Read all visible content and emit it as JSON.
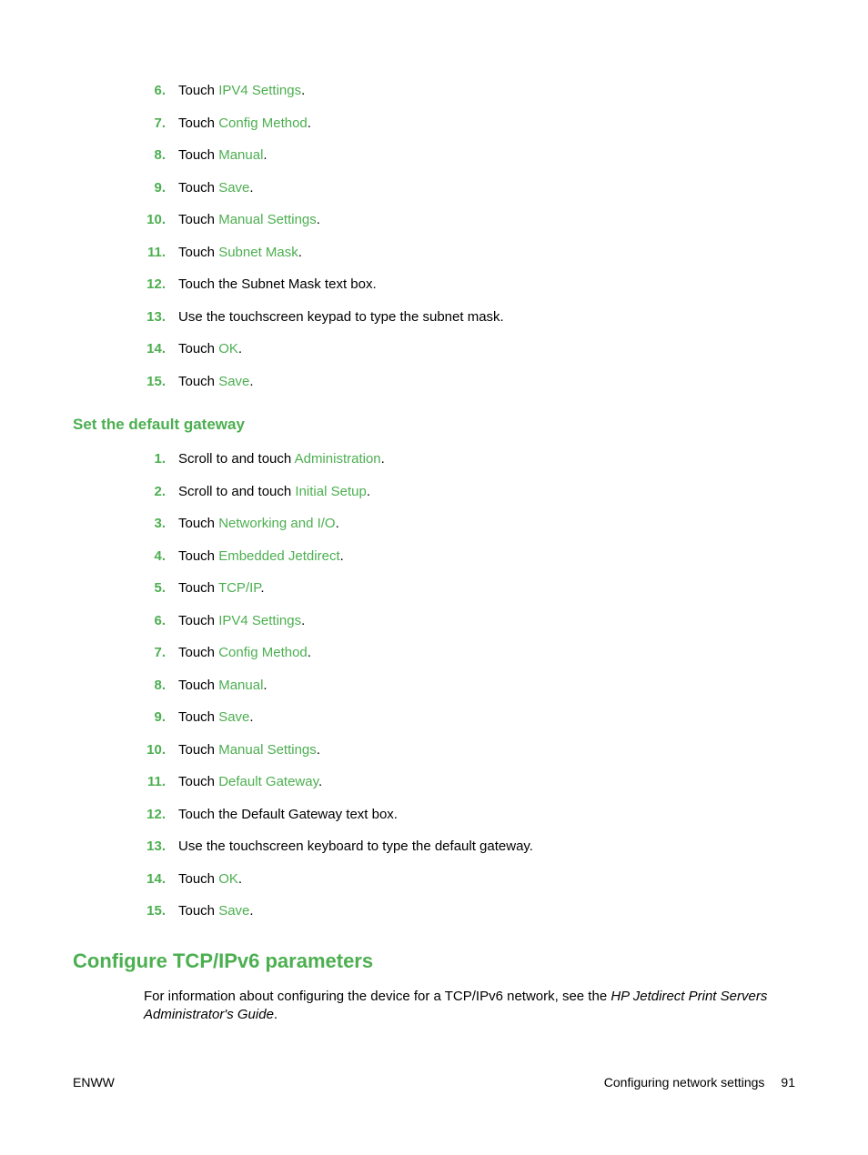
{
  "list1": [
    {
      "n": "6.",
      "pre": "Touch ",
      "link": "IPV4 Settings",
      "post": "."
    },
    {
      "n": "7.",
      "pre": "Touch ",
      "link": "Config Method",
      "post": "."
    },
    {
      "n": "8.",
      "pre": "Touch ",
      "link": "Manual",
      "post": "."
    },
    {
      "n": "9.",
      "pre": "Touch ",
      "link": "Save",
      "post": "."
    },
    {
      "n": "10.",
      "pre": "Touch ",
      "link": "Manual Settings",
      "post": "."
    },
    {
      "n": "11.",
      "pre": "Touch ",
      "link": "Subnet Mask",
      "post": "."
    },
    {
      "n": "12.",
      "pre": "Touch the Subnet Mask text box.",
      "link": "",
      "post": ""
    },
    {
      "n": "13.",
      "pre": "Use the touchscreen keypad to type the subnet mask.",
      "link": "",
      "post": ""
    },
    {
      "n": "14.",
      "pre": "Touch ",
      "link": "OK",
      "post": "."
    },
    {
      "n": "15.",
      "pre": "Touch ",
      "link": "Save",
      "post": "."
    }
  ],
  "subheading1": "Set the default gateway",
  "list2": [
    {
      "n": "1.",
      "pre": "Scroll to and touch ",
      "link": "Administration",
      "post": "."
    },
    {
      "n": "2.",
      "pre": "Scroll to and touch ",
      "link": "Initial Setup",
      "post": "."
    },
    {
      "n": "3.",
      "pre": "Touch ",
      "link": "Networking and I/O",
      "post": "."
    },
    {
      "n": "4.",
      "pre": "Touch ",
      "link": "Embedded Jetdirect",
      "post": "."
    },
    {
      "n": "5.",
      "pre": "Touch ",
      "link": "TCP/IP",
      "post": "."
    },
    {
      "n": "6.",
      "pre": "Touch ",
      "link": "IPV4 Settings",
      "post": "."
    },
    {
      "n": "7.",
      "pre": "Touch ",
      "link": "Config Method",
      "post": "."
    },
    {
      "n": "8.",
      "pre": "Touch ",
      "link": "Manual",
      "post": "."
    },
    {
      "n": "9.",
      "pre": "Touch ",
      "link": "Save",
      "post": "."
    },
    {
      "n": "10.",
      "pre": "Touch ",
      "link": "Manual Settings",
      "post": "."
    },
    {
      "n": "11.",
      "pre": "Touch ",
      "link": "Default Gateway",
      "post": "."
    },
    {
      "n": "12.",
      "pre": "Touch the Default Gateway text box.",
      "link": "",
      "post": ""
    },
    {
      "n": "13.",
      "pre": "Use the touchscreen keyboard to type the default gateway.",
      "link": "",
      "post": ""
    },
    {
      "n": "14.",
      "pre": "Touch ",
      "link": "OK",
      "post": "."
    },
    {
      "n": "15.",
      "pre": "Touch ",
      "link": "Save",
      "post": "."
    }
  ],
  "heading2": "Configure TCP/IPv6 parameters",
  "para": {
    "pre": "For information about configuring the device for a TCP/IPv6 network, see the ",
    "italic": "HP Jetdirect Print Servers Administrator's Guide",
    "post": "."
  },
  "footer": {
    "left": "ENWW",
    "rightText": "Configuring network settings",
    "pageNum": "91"
  }
}
